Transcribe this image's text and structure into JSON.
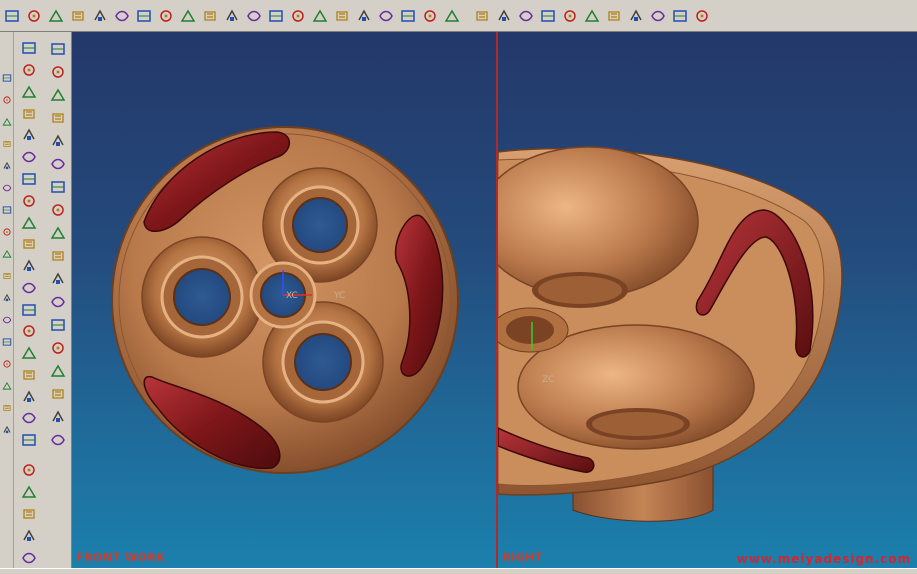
{
  "viewports": {
    "front": {
      "label": "FRONT WORK"
    },
    "right": {
      "label": "RIGHT"
    }
  },
  "watermark": "www.meiyadesign.com",
  "axes": {
    "zc": "ZC"
  },
  "colors": {
    "part_body": "#b97a4b",
    "part_highlight": "#e0a878",
    "part_shadow": "#6e3f1f",
    "grip_insert": "#8a1a1c",
    "background_top": "#24386a",
    "background_bottom": "#1b80ad",
    "label_red": "#d23a2a"
  },
  "toolbars": {
    "top": [
      "fillet-icon",
      "pattern-icon",
      "trim-icon",
      "extrude-icon",
      "revolve-icon",
      "sketch-icon",
      "grid-icon",
      "offset-icon",
      "table-icon",
      "section-icon",
      "feature-icon",
      "blend-icon",
      "move-icon",
      "layer-icon",
      "measure-icon",
      "stack-icon",
      "align-icon",
      "list-icon",
      "view-icon",
      "part-icon",
      "book-icon",
      "block-icon",
      "mirror-icon",
      "rotate-icon",
      "edit-icon",
      "surface-icon",
      "render-icon",
      "shade-icon",
      "cut-icon",
      "close-icon",
      "color-icon",
      "cube-icon"
    ],
    "left_a": [
      "curve-icon",
      "arc-icon",
      "spline-icon",
      "line-icon",
      "point-icon",
      "edge-icon",
      "corner-icon",
      "hole-icon",
      "chamfer-icon",
      "rib-icon",
      "shell-icon",
      "draft-icon",
      "thread-icon",
      "boss-icon",
      "cone-icon",
      "tube-icon",
      "wave-icon"
    ],
    "left_b": [
      "grid-icon",
      "sheet-icon",
      "extrude-icon",
      "box-icon",
      "pencil-icon",
      "hole-icon",
      "circle-icon",
      "cylinder-icon",
      "square-icon",
      "box-icon",
      "sphere-icon",
      "edit-icon",
      "stack-icon",
      "trim-icon",
      "layers-icon",
      "axis-icon",
      "nodes-icon",
      "gear-icon",
      "target-icon",
      "joint-icon",
      "cube-icon",
      "cylinder-icon",
      "cone-icon",
      "sphere-icon"
    ],
    "left_c": [
      "cube-icon",
      "sphere-icon",
      "wedge-icon",
      "gear-icon",
      "pencil-icon",
      "moon-icon",
      "cube-icon",
      "array-icon",
      "table-icon",
      "book-icon",
      "tool-icon",
      "pattern-icon",
      "cylinder-icon",
      "block-icon",
      "box-icon",
      "leaf-icon",
      "leaf-icon",
      "paint-icon"
    ]
  }
}
